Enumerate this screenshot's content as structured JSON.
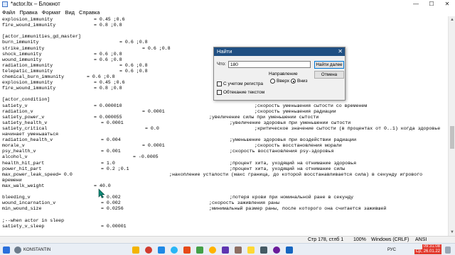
{
  "window": {
    "title": "*actor.ltx – Блокнот",
    "minimize": "—",
    "maximize": "☐",
    "close": "✕"
  },
  "menu": {
    "items": [
      {
        "label": "Файл"
      },
      {
        "label": "Правка"
      },
      {
        "label": "Формат"
      },
      {
        "label": "Вид"
      },
      {
        "label": "Справка"
      }
    ]
  },
  "editor": {
    "lines": [
      {
        "key": "explosion_immunity",
        "val": "= 0.45 ;0.6"
      },
      {
        "key": "fire_wound_immunity",
        "val": "= 0.8 ;0.8"
      },
      {
        "key": ""
      },
      {
        "key": "[actor_immunities_gd_master]"
      },
      {
        "key": "burn_immunity",
        "val": "= 0.6 ;0.8"
      },
      {
        "key": "strike_immunity",
        "val": "= 0.6 ;0.8"
      },
      {
        "key": "shock_immunity",
        "val": "= 0.6 ;0.8"
      },
      {
        "key": "wound_immunity",
        "val": "= 0.6 ;0.8"
      },
      {
        "key": "radiation_immunity",
        "val": "= 0.6 ;0.8"
      },
      {
        "key": "telepatic_immunity",
        "val": "= 0.6 ;0.8"
      },
      {
        "key": "chemical_burn_immunity",
        "val": "= 0.6 ;0.8"
      },
      {
        "key": "explosion_immunity",
        "val": "= 0.45 ;0.6"
      },
      {
        "key": "fire_wound_immunity",
        "val": "= 0.8 ;0.8"
      },
      {
        "key": ""
      },
      {
        "key": "[actor_condition]"
      },
      {
        "key": "satiety_v",
        "val": "= 0.000010",
        "comment": ";скорость уменьшения сытости со временем"
      },
      {
        "key": "radiation_v",
        "val": "= 0.0001",
        "comment": ";скорость уменьшения радиации"
      },
      {
        "key": "satiety_power_v",
        "val": "= 0.000055",
        "comment": ";увеличение силы при уменьшении сытости"
      },
      {
        "key": "satiety_health_v",
        "val": "= 0.0001",
        "comment": ";увеличение здоровья при уменьшении сытости"
      },
      {
        "key": "satiety_critical",
        "val": "= 0.0",
        "comment": ";критическое значение сытости (в процентах от 0..1) когда здоровье"
      },
      {
        "key": "начинает уменьшаться"
      },
      {
        "key": "radiation_health_v",
        "val": "= 0.004",
        "comment": ";уменьшение здоровья при воздействии радиации"
      },
      {
        "key": "morale_v",
        "val": "= 0.0001",
        "comment": ";скорость восстановления морали"
      },
      {
        "key": "psy_health_v",
        "val": "= 0.001",
        "comment": ";скорость восстановления psy-здоровья"
      },
      {
        "key": "alcohol_v",
        "val": "= -0.0005"
      },
      {
        "key": "health_hit_part",
        "val": "= 1.0",
        "comment": ";процент хита, уходящий на отнимание здоровья"
      },
      {
        "key": "power_hit_part",
        "val": "= 0.2 ;0.1",
        "comment": ";процент хита, уходящий на отнимание силы"
      },
      {
        "key": "max_power_leak_speed",
        "val": "= 0.0",
        "comment": ";накопление усталости (макс граница, до которой восстанавливается сила) в секунду игрового"
      },
      {
        "key": "времени"
      },
      {
        "key": "max_walk_weight",
        "val": "= 40.0"
      },
      {
        "key": ""
      },
      {
        "key": "bleeding_v",
        "val": "= 0.002",
        "comment": ";потеря крови при номинальной ране в секунду"
      },
      {
        "key": "wound_incarnation_v",
        "val": "= 0.002",
        "comment": ";скорость заживления раны"
      },
      {
        "key": "min_wound_size",
        "val": "= 0.0256",
        "comment": ";минимальный размер раны, после которого она считается зажившей"
      },
      {
        "key": ""
      },
      {
        "key": ";--when actor in sleep"
      },
      {
        "key": "satiety_v_sleep",
        "val": "= 0.00001"
      }
    ]
  },
  "find_dialog": {
    "title": "Найти",
    "close": "✕",
    "what_label": "Что:",
    "what_value": "180",
    "find_next": "Найти далее",
    "cancel": "Отмена",
    "direction_label": "Направление",
    "up": "Вверх",
    "down": "Вниз",
    "match_case": "С учетом регистра",
    "wrap": "Обтекание текстом"
  },
  "status": {
    "position": "Стр 178, стлб 1",
    "zoom": "100%",
    "eol": "Windows (CRLF)",
    "encoding": "ANSI"
  },
  "taskbar": {
    "user": "KONSTANTIN",
    "lang": "РУС",
    "time": "09:31:08",
    "date": "Ср, 26.01.22"
  }
}
